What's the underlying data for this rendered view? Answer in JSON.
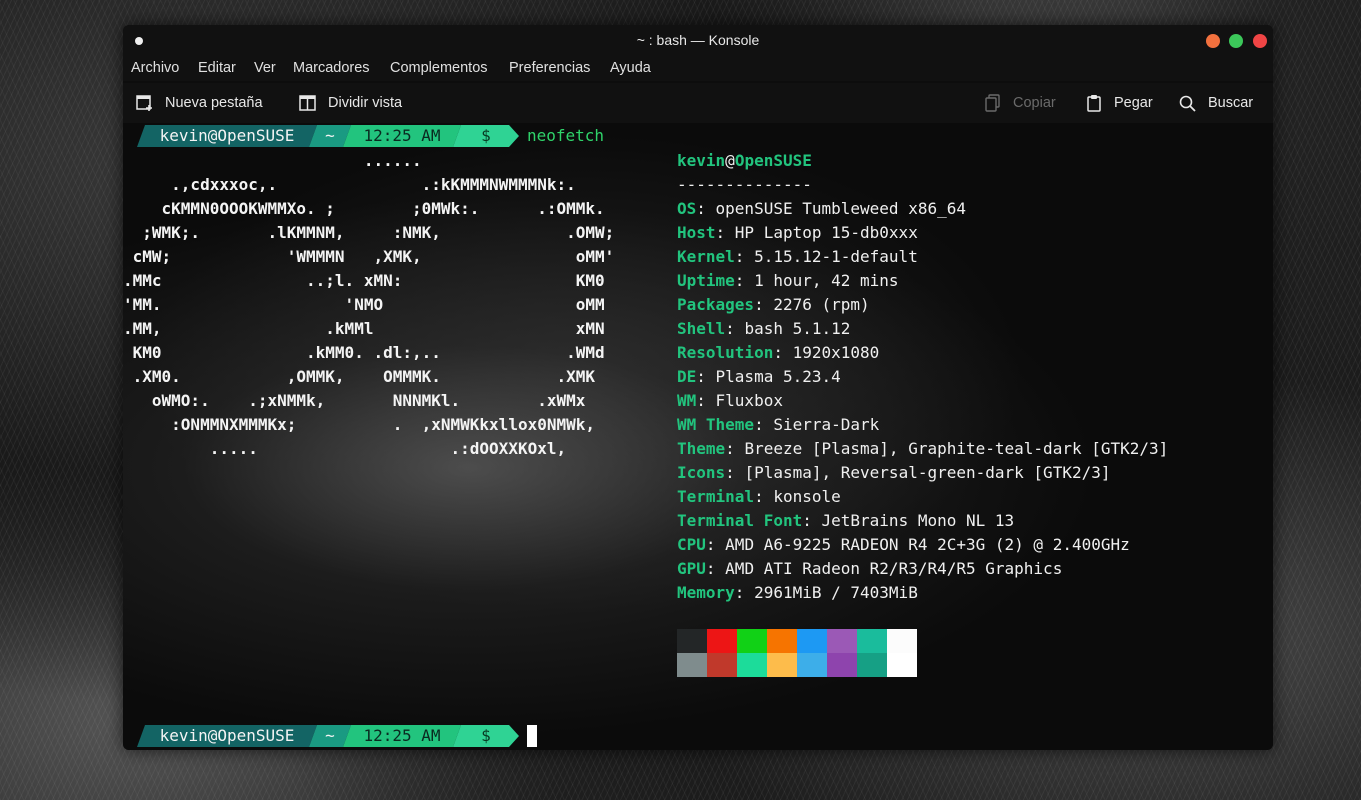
{
  "window": {
    "title": "~ : bash — Konsole",
    "buttons": {
      "minimize_color": "#f2713e",
      "maximize_color": "#3cc85a",
      "close_color": "#f04545"
    }
  },
  "menubar": {
    "items": [
      "Archivo",
      "Editar",
      "Ver",
      "Marcadores",
      "Complementos",
      "Preferencias",
      "Ayuda"
    ]
  },
  "toolbar": {
    "new_tab": "Nueva pestaña",
    "split_view": "Dividir vista",
    "copy": "Copiar",
    "paste": "Pegar",
    "find": "Buscar"
  },
  "prompt": {
    "user_host": "kevin@OpenSUSE",
    "dir": "~",
    "time": "12:25 AM",
    "symbol": "$",
    "command": "neofetch"
  },
  "ascii_logo": [
    "                         ......",
    "     .,cdxxxoc,.               .:kKMMMNWMMMNk:.",
    "    cKMMN0OOOKWMMXo. ;        ;0MWk:.      .:OMMk.",
    "  ;WMK;.       .lKMMNM,     :NMK,             .OMW;",
    " cMW;            'WMMMN   ,XMK,                oMM'",
    ".MMc               ..;l. xMN:                  KM0",
    "'MM.                   'NMO                    oMM",
    ".MM,                 .kMMl                     xMN",
    " KM0               .kMM0. .dl:,..             .WMd",
    " .XM0.           ,OMMK,    OMMMK.            .XMK",
    "   oWMO:.    .;xNMMk,       NNNMKl.        .xWMx",
    "     :ONMMNXMMMKx;          .  ,xNMWKkxllox0NMWk,",
    "         .....                    .:dOOXXKOxl,"
  ],
  "sysinfo": {
    "user": "kevin",
    "at": "@",
    "host": "OpenSUSE",
    "separator": "--------------",
    "fields": [
      {
        "key": "OS",
        "value": "openSUSE Tumbleweed x86_64"
      },
      {
        "key": "Host",
        "value": "HP Laptop 15-db0xxx"
      },
      {
        "key": "Kernel",
        "value": "5.15.12-1-default"
      },
      {
        "key": "Uptime",
        "value": "1 hour, 42 mins"
      },
      {
        "key": "Packages",
        "value": "2276 (rpm)"
      },
      {
        "key": "Shell",
        "value": "bash 5.1.12"
      },
      {
        "key": "Resolution",
        "value": "1920x1080"
      },
      {
        "key": "DE",
        "value": "Plasma 5.23.4"
      },
      {
        "key": "WM",
        "value": "Fluxbox"
      },
      {
        "key": "WM Theme",
        "value": "Sierra-Dark"
      },
      {
        "key": "Theme",
        "value": "Breeze [Plasma], Graphite-teal-dark [GTK2/3]"
      },
      {
        "key": "Icons",
        "value": "[Plasma], Reversal-green-dark [GTK2/3]"
      },
      {
        "key": "Terminal",
        "value": "konsole"
      },
      {
        "key": "Terminal Font",
        "value": "JetBrains Mono NL 13"
      },
      {
        "key": "CPU",
        "value": "AMD A6-9225 RADEON R4 2C+3G (2) @ 2.400GHz"
      },
      {
        "key": "GPU",
        "value": "AMD ATI Radeon R2/R3/R4/R5 Graphics"
      },
      {
        "key": "Memory",
        "value": "2961MiB / 7403MiB"
      }
    ]
  },
  "palette": {
    "row1": [
      "#232627",
      "#ed1515",
      "#11d116",
      "#f67400",
      "#1d99f3",
      "#9b59b6",
      "#1abc9c",
      "#fcfcfc"
    ],
    "row2": [
      "#7f8c8d",
      "#c0392b",
      "#1cdc9a",
      "#fdbc4b",
      "#3daee9",
      "#8e44ad",
      "#16a085",
      "#ffffff"
    ]
  },
  "colors": {
    "accent_green": "#22c47e",
    "prompt_user_bg": "#136464"
  }
}
